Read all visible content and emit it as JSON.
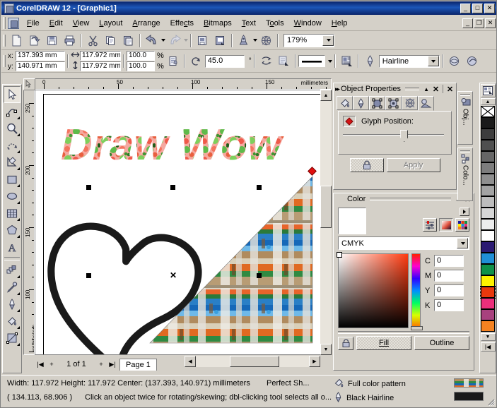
{
  "window": {
    "title": "CorelDRAW 12 - [Graphic1]",
    "min": "_",
    "max": "□",
    "close": "✕",
    "mdi_min": "_",
    "mdi_restore": "❐",
    "mdi_close": "✕"
  },
  "menu": {
    "items": [
      {
        "label": "File",
        "accel": "F"
      },
      {
        "label": "Edit",
        "accel": "E"
      },
      {
        "label": "View",
        "accel": "V"
      },
      {
        "label": "Layout",
        "accel": "L"
      },
      {
        "label": "Arrange",
        "accel": "A"
      },
      {
        "label": "Effects",
        "accel": "c"
      },
      {
        "label": "Bitmaps",
        "accel": "B"
      },
      {
        "label": "Text",
        "accel": "T"
      },
      {
        "label": "Tools",
        "accel": "o"
      },
      {
        "label": "Window",
        "accel": "W"
      },
      {
        "label": "Help",
        "accel": "H"
      }
    ]
  },
  "standard_toolbar": {
    "buttons": [
      {
        "name": "new-document-button",
        "tip": "New"
      },
      {
        "name": "open-document-button",
        "tip": "Open"
      },
      {
        "name": "save-document-button",
        "tip": "Save"
      },
      {
        "name": "print-button",
        "tip": "Print"
      },
      {
        "name": "cut-button",
        "tip": "Cut"
      },
      {
        "name": "copy-button",
        "tip": "Copy"
      },
      {
        "name": "paste-button",
        "tip": "Paste"
      },
      {
        "name": "undo-button",
        "tip": "Undo"
      },
      {
        "name": "redo-button",
        "tip": "Redo"
      },
      {
        "name": "import-button",
        "tip": "Import"
      },
      {
        "name": "export-button",
        "tip": "Export"
      },
      {
        "name": "application-launcher-button",
        "tip": "Application Launcher"
      },
      {
        "name": "corel-online-button",
        "tip": "Corel Online"
      }
    ],
    "zoom_level": "179%"
  },
  "property_bar": {
    "x_label": "x:",
    "x_value": "137.393 mm",
    "y_label": "y:",
    "y_value": "140.971 mm",
    "width_value": "117.972 mm",
    "height_value": "117.972 mm",
    "scale_h": "100.0",
    "scale_v": "100.0",
    "percent": "%",
    "rotation_value": "45.0",
    "degree": "°",
    "outline_width": "Hairline"
  },
  "toolbox": {
    "tools": [
      {
        "name": "pick-tool",
        "label": "Pick",
        "selected": true,
        "flyout": false
      },
      {
        "name": "shape-tool",
        "label": "Shape",
        "selected": false,
        "flyout": true
      },
      {
        "name": "zoom-tool",
        "label": "Zoom",
        "selected": false,
        "flyout": true
      },
      {
        "name": "freehand-tool",
        "label": "Freehand",
        "selected": false,
        "flyout": true
      },
      {
        "name": "smart-drawing-tool",
        "label": "Smart Drawing",
        "selected": false,
        "flyout": true
      },
      {
        "name": "rectangle-tool",
        "label": "Rectangle",
        "selected": false,
        "flyout": true
      },
      {
        "name": "ellipse-tool",
        "label": "Ellipse",
        "selected": false,
        "flyout": true
      },
      {
        "name": "graph-paper-tool",
        "label": "Graph Paper",
        "selected": false,
        "flyout": true
      },
      {
        "name": "polygon-tool",
        "label": "Polygon",
        "selected": false,
        "flyout": true
      },
      {
        "name": "text-tool",
        "label": "Text",
        "selected": false,
        "flyout": false
      },
      {
        "name": "interactive-blend-tool",
        "label": "Interactive Blend",
        "selected": false,
        "flyout": true
      },
      {
        "name": "eyedropper-tool",
        "label": "Eyedropper",
        "selected": false,
        "flyout": true
      },
      {
        "name": "outline-tool",
        "label": "Outline",
        "selected": false,
        "flyout": true
      },
      {
        "name": "fill-tool",
        "label": "Fill",
        "selected": false,
        "flyout": true
      },
      {
        "name": "interactive-fill-tool",
        "label": "Interactive Fill",
        "selected": false,
        "flyout": true
      }
    ]
  },
  "rulers": {
    "unit_label": "millimeters",
    "horizontal_ticks": [
      "0",
      "50",
      "100",
      "150"
    ],
    "vertical_ticks": [
      "250",
      "200",
      "150",
      "100"
    ]
  },
  "canvas": {
    "text_object": "Draw Wow",
    "page_label": "Page 1",
    "page_count": "1 of 1"
  },
  "page_nav": {
    "first": "|◀",
    "add_before": "+",
    "counter": "1 of 1",
    "add_after": "+",
    "last": "▶|",
    "tab_label": "Page 1"
  },
  "object_properties": {
    "title": "Object Properties",
    "collapse": "▲",
    "close_panel": "✕",
    "close_docker": "✕",
    "tabs": [
      {
        "name": "fill-tab",
        "label": "Fill",
        "active": false
      },
      {
        "name": "outline-tab",
        "label": "Outline",
        "active": false
      },
      {
        "name": "rectangle-tab",
        "label": "Rectangle",
        "active": false
      },
      {
        "name": "general-tab",
        "label": "General",
        "active": false
      },
      {
        "name": "interactive-fill-tab",
        "label": "Interactive",
        "active": false
      },
      {
        "name": "internet-tab",
        "label": "Internet",
        "active": true
      }
    ],
    "glyph_label": "Glyph Position:",
    "apply_label": "Apply",
    "lock_label": "Lock"
  },
  "color_docker": {
    "title": "Color",
    "collapse": "▲",
    "close": "✕",
    "model": "CMYK",
    "channels": [
      {
        "label": "C",
        "value": "0"
      },
      {
        "label": "M",
        "value": "0"
      },
      {
        "label": "Y",
        "value": "0"
      },
      {
        "label": "K",
        "value": "0"
      }
    ],
    "fill_button": "Fill",
    "outline_button": "Outline",
    "current_color": "#ffffff"
  },
  "docker_tabs": {
    "items": [
      {
        "name": "docker-tab-object-properties",
        "label": "Obj..."
      },
      {
        "name": "docker-tab-color",
        "label": "Colo..."
      }
    ]
  },
  "palette": {
    "scroll_up": "▲",
    "scroll_down": "▼",
    "expand": "|◀",
    "no_color": "X",
    "colors": [
      {
        "hex": "#ffffff",
        "name": "none",
        "selected": false
      },
      {
        "hex": "#1a1a1a",
        "name": "black",
        "selected": false
      },
      {
        "hex": "#3d3d3d",
        "name": "90% black",
        "selected": false
      },
      {
        "hex": "#4f4f4f",
        "name": "80% black",
        "selected": false
      },
      {
        "hex": "#666666",
        "name": "70% black",
        "selected": false
      },
      {
        "hex": "#7d7d7d",
        "name": "60% black",
        "selected": false
      },
      {
        "hex": "#8f8f8f",
        "name": "50% black",
        "selected": false
      },
      {
        "hex": "#a3a3a3",
        "name": "40% black",
        "selected": false
      },
      {
        "hex": "#bdbdbd",
        "name": "30% black",
        "selected": false
      },
      {
        "hex": "#d6d6d6",
        "name": "20% black",
        "selected": false
      },
      {
        "hex": "#ededed",
        "name": "10% black",
        "selected": false
      },
      {
        "hex": "#ffffff",
        "name": "white",
        "selected": false
      },
      {
        "hex": "#2b1a72",
        "name": "blue",
        "selected": false
      },
      {
        "hex": "#1f8fd6",
        "name": "cyan",
        "selected": false
      },
      {
        "hex": "#0f9149",
        "name": "green",
        "selected": false
      },
      {
        "hex": "#fff200",
        "name": "yellow",
        "selected": false
      },
      {
        "hex": "#e8380d",
        "name": "red",
        "selected": true
      },
      {
        "hex": "#ec2f7b",
        "name": "magenta",
        "selected": false
      },
      {
        "hex": "#a8417e",
        "name": "purple",
        "selected": false
      },
      {
        "hex": "#f58220",
        "name": "orange",
        "selected": false
      }
    ]
  },
  "status_bar": {
    "dimensions": "Width: 117.972  Height: 117.972  Center: (137.393, 140.971)  millimeters",
    "object_type": "Perfect Sh...",
    "cursor_pos": "( 134.113, 68.906 )",
    "hint": "Click an object twice for rotating/skewing; dbl-clicking tool selects all o...",
    "fill_label": "Full color pattern",
    "outline_label": "Black  Hairline"
  }
}
